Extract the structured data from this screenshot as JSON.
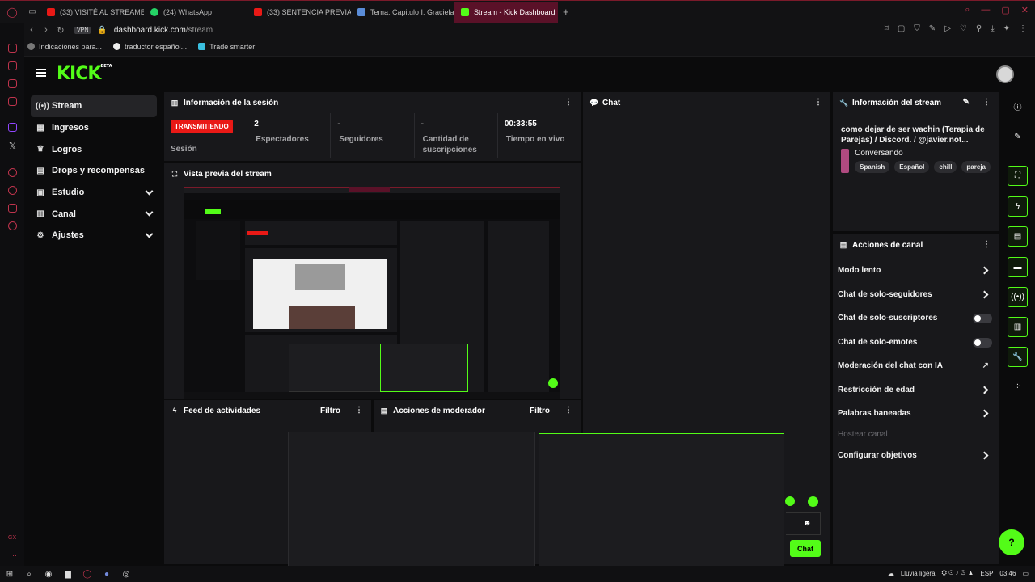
{
  "browser": {
    "tabs": [
      {
        "label": "(33) VISITÉ AL STREAMER",
        "color": "#e91916",
        "active": false
      },
      {
        "label": "(24) WhatsApp",
        "color": "#25d366",
        "active": false
      },
      {
        "label": "(33) SENTENCIA PREVIA",
        "color": "#e91916",
        "active": false
      },
      {
        "label": "Tema: Capitulo I: Gracielaa",
        "color": "#5a8cd8",
        "active": false
      },
      {
        "label": "Stream - Kick Dashboard",
        "color": "#53fc18",
        "active": true
      }
    ],
    "add_tab": "+",
    "vpn_label": "VPN",
    "url_host": "dashboard.kick.com",
    "url_path": "/stream",
    "bookmarks": [
      "Indicaciones para...",
      "traductor español...",
      "Trade smarter"
    ]
  },
  "header": {
    "logo": "KICK",
    "logo_sup": "BETA"
  },
  "nav": {
    "items": [
      {
        "label": "Stream",
        "icon": "((•))",
        "active": true,
        "expand": false
      },
      {
        "label": "Ingresos",
        "icon": "▦",
        "active": false,
        "expand": false
      },
      {
        "label": "Logros",
        "icon": "🏆",
        "active": false,
        "expand": false
      },
      {
        "label": "Drops y recompensas",
        "icon": "▤",
        "active": false,
        "expand": false
      },
      {
        "label": "Estudio",
        "icon": "▣",
        "active": false,
        "expand": true
      },
      {
        "label": "Canal",
        "icon": "▥",
        "active": false,
        "expand": true
      },
      {
        "label": "Ajustes",
        "icon": "⚙",
        "active": false,
        "expand": true
      }
    ]
  },
  "session": {
    "title": "Información de la sesión",
    "live_badge": "TRANSMITIENDO",
    "live_label": "Sesión",
    "stats": [
      {
        "value": "2",
        "label": "Espectadores"
      },
      {
        "value": "-",
        "label": "Seguidores"
      },
      {
        "value": "-",
        "label": "Cantidad de suscripciones"
      },
      {
        "value": "00:33:55",
        "label": "Tiempo en vivo"
      }
    ]
  },
  "preview": {
    "title": "Vista previa del stream"
  },
  "activity": {
    "title": "Feed de actividades",
    "filter": "Filtro"
  },
  "modactions": {
    "title": "Acciones de moderador",
    "filter": "Filtro"
  },
  "chat": {
    "title": "Chat",
    "send_label": "Chat"
  },
  "stream_info": {
    "title": "Información del stream",
    "stream_title": "como dejar de ser wachin (Terapia de Parejas) / Discord. / @javier.not...",
    "category": "Conversando",
    "tags": [
      "Spanish",
      "Español",
      "chill",
      "pareja"
    ]
  },
  "channel_actions": {
    "title": "Acciones de canal",
    "items": [
      {
        "label": "Modo lento",
        "control": "chevron"
      },
      {
        "label": "Chat de solo-seguidores",
        "control": "chevron"
      },
      {
        "label": "Chat de solo-suscriptores",
        "control": "toggle"
      },
      {
        "label": "Chat de solo-emotes",
        "control": "toggle"
      },
      {
        "label": "Moderación del chat con IA",
        "control": "external"
      },
      {
        "label": "Restricción de edad",
        "control": "chevron"
      },
      {
        "label": "Palabras baneadas",
        "control": "chevron"
      },
      {
        "label": "Hostear canal",
        "control": "disabled"
      },
      {
        "label": "Configurar objetivos",
        "control": "chevron"
      }
    ]
  },
  "taskbar": {
    "weather": "Lluvia ligera",
    "lang": "ESP",
    "time": "03:46"
  },
  "colors": {
    "accent": "#53fc18",
    "live": "#e91916",
    "panel": "#18181b",
    "bg": "#0b0b0c"
  }
}
